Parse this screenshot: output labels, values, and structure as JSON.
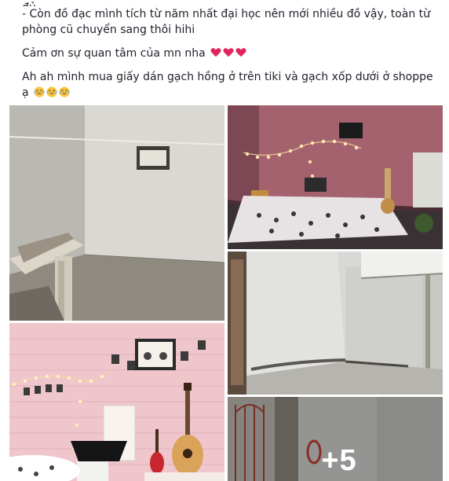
{
  "post": {
    "line_cut": "đủ.",
    "line1": "- Còn đồ đạc mình tích từ năm nhất đại học nên mới nhiều đồ vậy, toàn từ",
    "line2": "phòng cũ chuyển sang thôi hihi",
    "thanks": "Cảm ơn sự quan tâm của mn nha",
    "thanks_emoji": "red-heart x3",
    "ah_line1": "Ah ah mình mua giấy dán gạch hồng ở trên tiki và gạch xốp dưới ở shoppe",
    "ah_line2": "ạ",
    "ah_emoji": "face-with-tears-of-joy x3"
  },
  "gallery": {
    "photos": [
      {
        "name": "photo-empty-room-before",
        "desc": "empty white room with stair railing"
      },
      {
        "name": "photo-pink-room-night",
        "desc": "pink room with fairy lights at night"
      },
      {
        "name": "photo-corner-room-before",
        "desc": "empty room corner with loft"
      },
      {
        "name": "photo-pink-brick-wall",
        "desc": "pink brick wall with guitar and lights"
      },
      {
        "name": "photo-stairs-entry",
        "desc": "stair entry with mirror"
      }
    ],
    "more_count": "+5"
  },
  "colors": {
    "text": "#1d2129",
    "heart": "#e0245e",
    "overlay": "rgba(0,0,0,0.35)"
  }
}
